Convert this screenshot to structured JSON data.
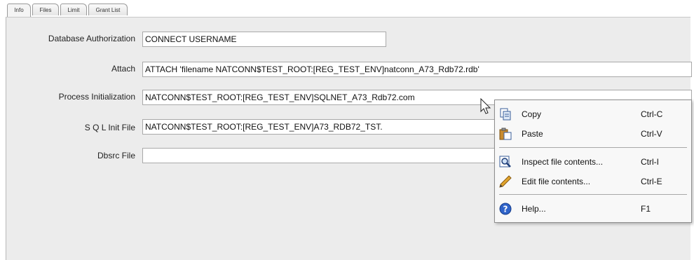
{
  "tabs": [
    {
      "label": "Info"
    },
    {
      "label": "Files"
    },
    {
      "label": "Limit"
    },
    {
      "label": "Grant List"
    }
  ],
  "form": {
    "database_authorization": {
      "label": "Database Authorization",
      "value": "CONNECT USERNAME"
    },
    "attach": {
      "label": "Attach",
      "value": "ATTACH 'filename NATCONN$TEST_ROOT:[REG_TEST_ENV]natconn_A73_Rdb72.rdb'"
    },
    "process_initialization": {
      "label": "Process Initialization",
      "value": "NATCONN$TEST_ROOT:[REG_TEST_ENV]SQLNET_A73_Rdb72.com"
    },
    "sql_init_file": {
      "label": "S Q L Init File",
      "value": "NATCONN$TEST_ROOT:[REG_TEST_ENV]A73_RDB72_TST."
    },
    "dbsrc_file": {
      "label": "Dbsrc File",
      "value": ""
    }
  },
  "context_menu": {
    "items": [
      {
        "label": "Copy",
        "shortcut": "Ctrl-C",
        "icon": "copy-icon"
      },
      {
        "label": "Paste",
        "shortcut": "Ctrl-V",
        "icon": "paste-icon"
      },
      {
        "label": "Inspect file contents...",
        "shortcut": "Ctrl-I",
        "icon": "inspect-icon"
      },
      {
        "label": "Edit file contents...",
        "shortcut": "Ctrl-E",
        "icon": "pencil-icon"
      },
      {
        "label": "Help...",
        "shortcut": "F1",
        "icon": "help-icon"
      }
    ]
  }
}
